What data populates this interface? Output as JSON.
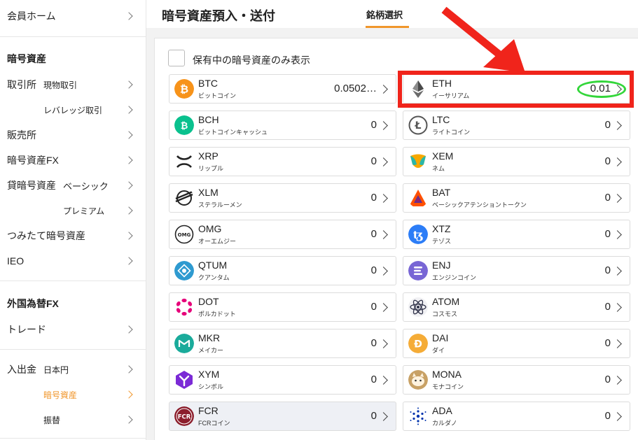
{
  "sidebar": {
    "member_home": "会員ホーム",
    "crypto_header": "暗号資産",
    "exchange": "取引所",
    "spot": "現物取引",
    "leverage": "レバレッジ取引",
    "store": "販売所",
    "crypto_fx": "暗号資産FX",
    "lending": "貸暗号資産",
    "basic": "ベーシック",
    "premium": "プレミアム",
    "tsumitate": "つみたて暗号資産",
    "ieo": "IEO",
    "forex_header": "外国為替FX",
    "trade": "トレード",
    "deposit": "入出金",
    "yen": "日本円",
    "crypto": "暗号資産",
    "transfer": "振替"
  },
  "header": {
    "title": "暗号資産預入・送付",
    "tab": "銘柄選択"
  },
  "filter": {
    "label": "保有中の暗号資産のみ表示",
    "checked": false
  },
  "coins": [
    {
      "symbol": "BTC",
      "name": "ビットコイン",
      "balance": "0.0502…",
      "color": "#f7931a"
    },
    {
      "symbol": "ETH",
      "name": "イーサリアム",
      "balance": "0.01",
      "color": "#627eea"
    },
    {
      "symbol": "BCH",
      "name": "ビットコインキャッシュ",
      "balance": "0",
      "color": "#0ac18e"
    },
    {
      "symbol": "LTC",
      "name": "ライトコイン",
      "balance": "0",
      "color": "#8a8a8a"
    },
    {
      "symbol": "XRP",
      "name": "リップル",
      "balance": "0",
      "color": "#222222"
    },
    {
      "symbol": "XEM",
      "name": "ネム",
      "balance": "0",
      "color": "#2ab7a9"
    },
    {
      "symbol": "XLM",
      "name": "ステラルーメン",
      "balance": "0",
      "color": "#222222"
    },
    {
      "symbol": "BAT",
      "name": "ベーシックアテンショントークン",
      "balance": "0",
      "color": "#ff5000"
    },
    {
      "symbol": "OMG",
      "name": "オーエムジー",
      "balance": "0",
      "color": "#222222"
    },
    {
      "symbol": "XTZ",
      "name": "テゾス",
      "balance": "0",
      "color": "#2c7df7"
    },
    {
      "symbol": "QTUM",
      "name": "クアンタム",
      "balance": "0",
      "color": "#2e9ad0"
    },
    {
      "symbol": "ENJ",
      "name": "エンジンコイン",
      "balance": "0",
      "color": "#7866d5"
    },
    {
      "symbol": "DOT",
      "name": "ポルカドット",
      "balance": "0",
      "color": "#e6007a"
    },
    {
      "symbol": "ATOM",
      "name": "コスモス",
      "balance": "0",
      "color": "#2e3148"
    },
    {
      "symbol": "MKR",
      "name": "メイカー",
      "balance": "0",
      "color": "#1aab9b"
    },
    {
      "symbol": "DAI",
      "name": "ダイ",
      "balance": "0",
      "color": "#f5ac37"
    },
    {
      "symbol": "XYM",
      "name": "シンボル",
      "balance": "0",
      "color": "#7b2ad6"
    },
    {
      "symbol": "MONA",
      "name": "モナコイン",
      "balance": "0",
      "color": "#c8a165"
    },
    {
      "symbol": "FCR",
      "name": "FCRコイン",
      "balance": "0",
      "color": "#8b1d2c"
    },
    {
      "symbol": "ADA",
      "name": "カルダノ",
      "balance": "0",
      "color": "#0033ad"
    }
  ],
  "colors": {
    "accent": "#f0962b",
    "annotation_red": "#f0241b",
    "annotation_green": "#33d63a"
  }
}
